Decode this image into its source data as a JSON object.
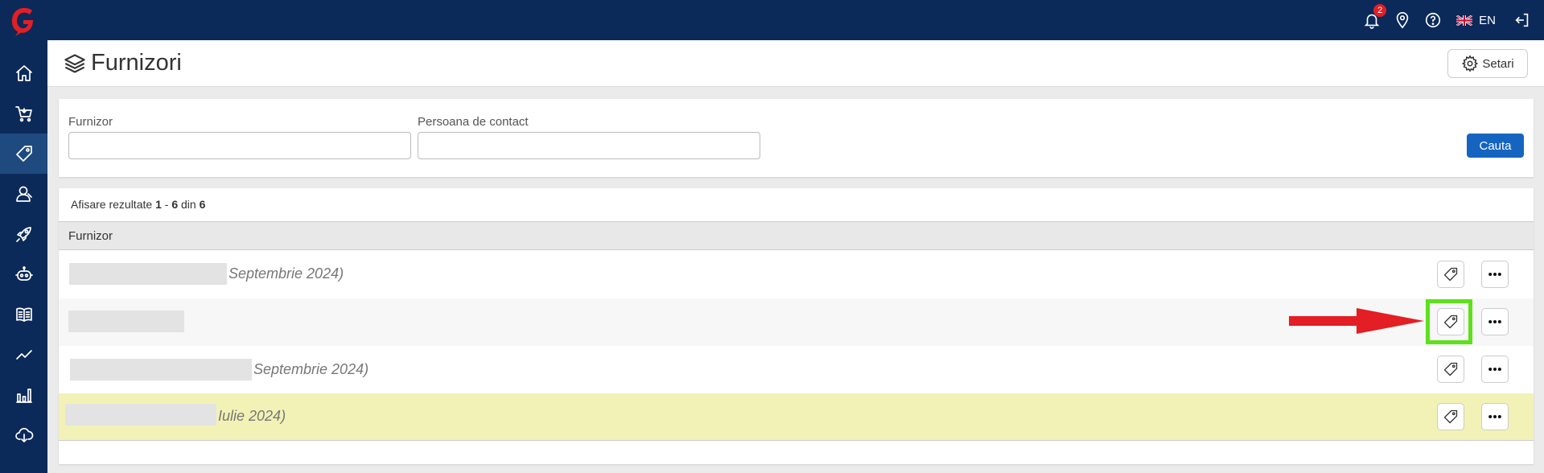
{
  "topbar": {
    "notification_count": "2",
    "language": "EN",
    "icons": [
      "bell-icon",
      "location-pin-icon",
      "help-icon",
      "flag-uk-icon",
      "logout-icon"
    ]
  },
  "sidebar": {
    "items": [
      {
        "name": "home-icon",
        "active": false
      },
      {
        "name": "cart-icon",
        "active": false
      },
      {
        "name": "tag-icon",
        "active": true
      },
      {
        "name": "user-icon",
        "active": false
      },
      {
        "name": "rocket-icon",
        "active": false
      },
      {
        "name": "robot-icon",
        "active": false
      },
      {
        "name": "book-icon",
        "active": false
      },
      {
        "name": "trend-icon",
        "active": false
      },
      {
        "name": "bar-chart-icon",
        "active": false
      },
      {
        "name": "cloud-download-icon",
        "active": false
      }
    ]
  },
  "header": {
    "title": "Furnizori",
    "settings_label": "Setari"
  },
  "filters": {
    "supplier_label": "Furnizor",
    "supplier_value": "",
    "contact_label": "Persoana de contact",
    "contact_value": "",
    "search_label": "Cauta"
  },
  "results": {
    "prefix": "Afisare rezultate",
    "from": "1",
    "separator": "-",
    "to": "6",
    "of_label": "din",
    "total": "6",
    "column_supplier": "Furnizor",
    "rows": [
      {
        "text": "Septembrie 2024)"
      },
      {
        "text": ""
      },
      {
        "text": "Septembrie 2024)"
      },
      {
        "text": "Iulie 2024)"
      }
    ]
  },
  "colors": {
    "topbar": "#0b2a5a",
    "sidebar_active": "#1e4a80",
    "primary_button": "#1565c0",
    "highlight_row": "#f2f2b6",
    "annotation_box": "#5ee11a",
    "annotation_arrow": "#e31e24"
  }
}
